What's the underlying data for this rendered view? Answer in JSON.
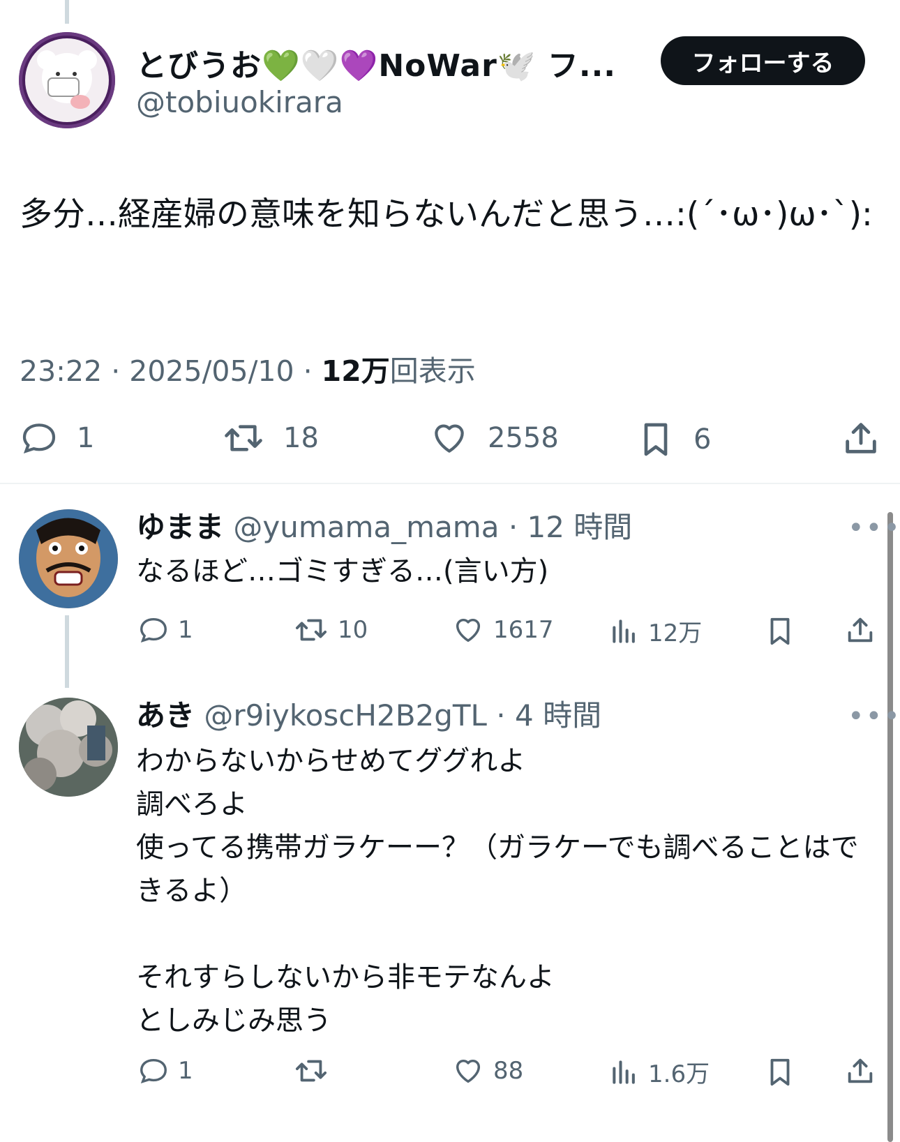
{
  "main_tweet": {
    "display_name": "とびうお💚🤍💜NoWar🕊️ フ...",
    "handle": "@tobiuokirara",
    "follow_label": "フォローする",
    "text": "多分…経産婦の意味を知らないんだと思う…:(´･ω･)ω･`):",
    "time": "23:22 · 2025/05/10 · ",
    "views_count": "12万",
    "views_label": "回表示",
    "actions": {
      "replies": "1",
      "retweets": "18",
      "likes": "2558",
      "bookmarks": "6"
    }
  },
  "replies": [
    {
      "display_name": "ゆまま",
      "handle": "@yumama_mama",
      "time": "· 12 時間",
      "more": "•••",
      "text": "なるほど…ゴミすぎる…(言い方)",
      "actions": {
        "replies": "1",
        "retweets": "10",
        "likes": "1617",
        "views": "12万"
      }
    },
    {
      "display_name": "あき",
      "handle": "@r9iykoscH2B2gTL",
      "time": "· 4 時間",
      "more": "•••",
      "text": "わからないからせめてググれよ\n調べろよ\n使ってる携帯ガラケーー？（ガラケーでも調べることはできるよ）\n\nそれすらしないから非モテなんよ\nとしみじみ思う",
      "actions": {
        "replies": "1",
        "retweets": "",
        "likes": "88",
        "views": "1.6万"
      }
    }
  ],
  "colors": {
    "text": "#0f1419",
    "secondary": "#536471",
    "follow_bg": "#0f1419",
    "divider": "#eff3f4"
  }
}
